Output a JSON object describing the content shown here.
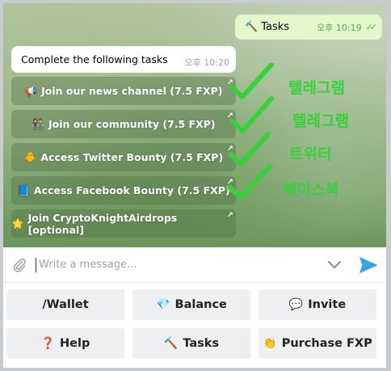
{
  "messages": {
    "outgoing": {
      "icon": "🔨",
      "text": "Tasks",
      "time": "오후 10:19",
      "status": "read-ticks"
    },
    "incoming": {
      "text": "Complete the following tasks",
      "time": "오후 10:20"
    }
  },
  "inline_buttons": [
    {
      "icon": "📢",
      "label": "Join our news channel (7.5 FXP)",
      "link_arrow": "↗"
    },
    {
      "icon": "👫",
      "label": "Join our community (7.5 FXP)",
      "link_arrow": "↗"
    },
    {
      "icon": "🐥",
      "label": "Access Twitter Bounty (7.5 FXP)",
      "link_arrow": "↗"
    },
    {
      "icon": "📘",
      "label": "Access Facebook Bounty (7.5 FXP)",
      "link_arrow": "↗"
    },
    {
      "icon": "🌟",
      "label": "Join CryptoKnightAirdrops [optional]",
      "link_arrow": "↗"
    }
  ],
  "annotations": [
    "텔레그램",
    "텔레그램",
    "트위터",
    "페이스북"
  ],
  "annotation_color": "#37d13a",
  "composer": {
    "placeholder": "Write a message..."
  },
  "keyboard": {
    "row1": [
      {
        "icon": "",
        "label": "/Wallet"
      },
      {
        "icon": "💎",
        "label": "Balance"
      },
      {
        "icon": "💬",
        "label": "Invite"
      }
    ],
    "row2": [
      {
        "icon": "❓",
        "label": "Help"
      },
      {
        "icon": "🔨",
        "label": "Tasks"
      },
      {
        "icon": "👏",
        "label": "Purchase FXP"
      }
    ]
  },
  "colors": {
    "outgoing_bubble": "#e2f7cb",
    "time_green": "#4fae4e",
    "send_blue": "#3aa4e0",
    "keyboard_button": "#edeff1"
  }
}
